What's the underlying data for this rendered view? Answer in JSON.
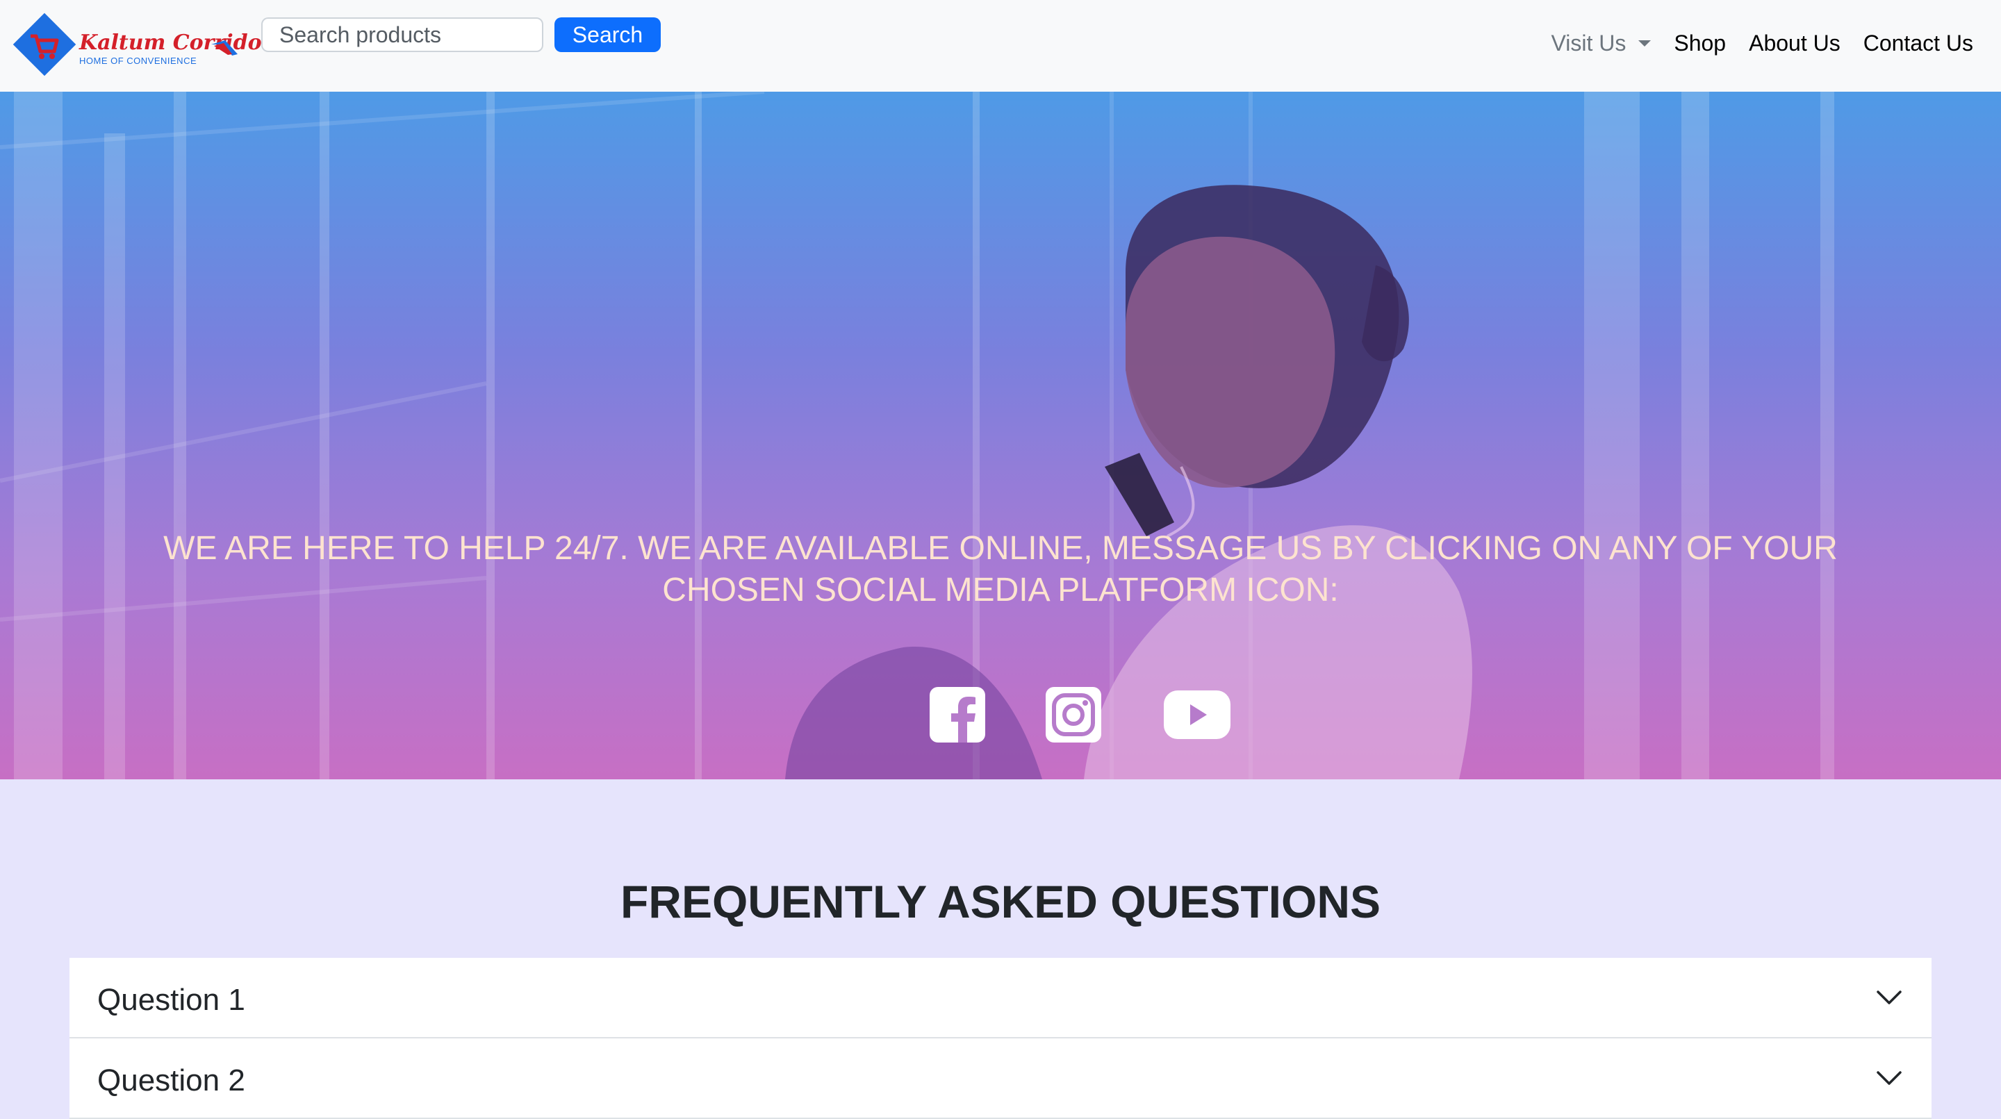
{
  "brand": {
    "name": "Kaltum Corridor",
    "tagline": "HOME OF CONVENIENCE"
  },
  "search": {
    "placeholder": "Search products",
    "button_label": "Search"
  },
  "nav": {
    "items": [
      {
        "label": "Visit Us",
        "dropdown": true
      },
      {
        "label": "Shop"
      },
      {
        "label": "About Us"
      },
      {
        "label": "Contact Us"
      }
    ]
  },
  "hero": {
    "message": "WE ARE HERE TO HELP 24/7. WE ARE AVAILABLE ONLINE, MESSAGE US BY CLICKING ON ANY OF YOUR CHOSEN SOCIAL MEDIA PLATFORM ICON:",
    "socials": [
      "facebook-icon",
      "instagram-icon",
      "youtube-icon"
    ]
  },
  "faq": {
    "title": "FREQUENTLY ASKED QUESTIONS",
    "items": [
      {
        "label": "Question 1"
      },
      {
        "label": "Question 2"
      }
    ]
  },
  "colors": {
    "accent": "#0d6efd",
    "brand_red": "#d4202a",
    "brand_blue": "#1e6fe0",
    "hero_text": "#fde3cf",
    "faq_bg": "#e6e4fc"
  }
}
